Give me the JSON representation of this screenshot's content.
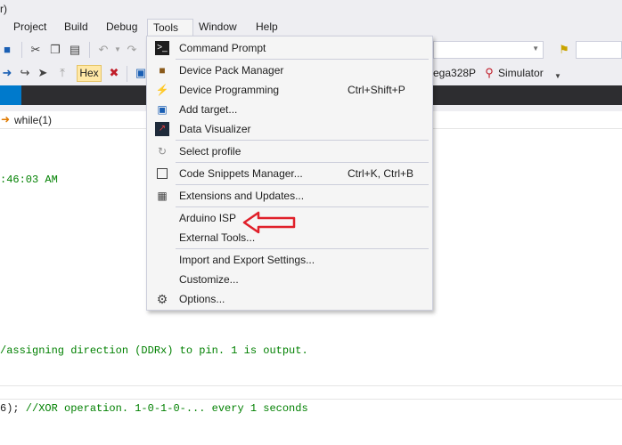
{
  "window": {
    "title_fragment": "r)"
  },
  "menubar": {
    "items": [
      {
        "label": "Project"
      },
      {
        "label": "Build"
      },
      {
        "label": "Debug"
      },
      {
        "label": "Tools"
      },
      {
        "label": "Window"
      },
      {
        "label": "Help"
      }
    ]
  },
  "toolbar2": {
    "hex_label": "Hex",
    "device_label": "ega328P",
    "debugger_label": "Simulator"
  },
  "editor": {
    "breadcrumb": "while(1)",
    "lines": [
      {
        "text": ":46:03 AM",
        "style": "comment"
      },
      {
        "text": "/assigning direction (DDRx) to pin. 1 is output.",
        "style": "comment"
      },
      {
        "code": "6);",
        "comment": " //XOR operation. 1-0-1-0-... every 1 seconds"
      }
    ]
  },
  "tools_menu": {
    "items": [
      {
        "label": "Command Prompt",
        "shortcut": "",
        "icon": "command-prompt-icon"
      },
      {
        "label": "Device Pack Manager",
        "shortcut": "",
        "icon": "package-icon"
      },
      {
        "label": "Device Programming",
        "shortcut": "Ctrl+Shift+P",
        "icon": "programming-icon"
      },
      {
        "label": "Add target...",
        "shortcut": "",
        "icon": "add-target-icon"
      },
      {
        "label": "Data Visualizer",
        "shortcut": "",
        "icon": "visualizer-icon"
      },
      {
        "label": "Select profile",
        "shortcut": "",
        "icon": "profile-icon"
      },
      {
        "label": "Code Snippets Manager...",
        "shortcut": "Ctrl+K, Ctrl+B",
        "icon": "checkbox-icon"
      },
      {
        "label": "Extensions and Updates...",
        "shortcut": "",
        "icon": "extensions-icon"
      },
      {
        "label": "Arduino ISP",
        "shortcut": "",
        "icon": ""
      },
      {
        "label": "External Tools...",
        "shortcut": "",
        "icon": ""
      },
      {
        "label": "Import and Export Settings...",
        "shortcut": "",
        "icon": ""
      },
      {
        "label": "Customize...",
        "shortcut": "",
        "icon": ""
      },
      {
        "label": "Options...",
        "shortcut": "",
        "icon": "gear-icon"
      }
    ]
  },
  "colors": {
    "annotation_arrow": "#e0202a",
    "menu_highlight": "#c9def5",
    "comment_green": "#008000",
    "accent_blue": "#007acc"
  }
}
